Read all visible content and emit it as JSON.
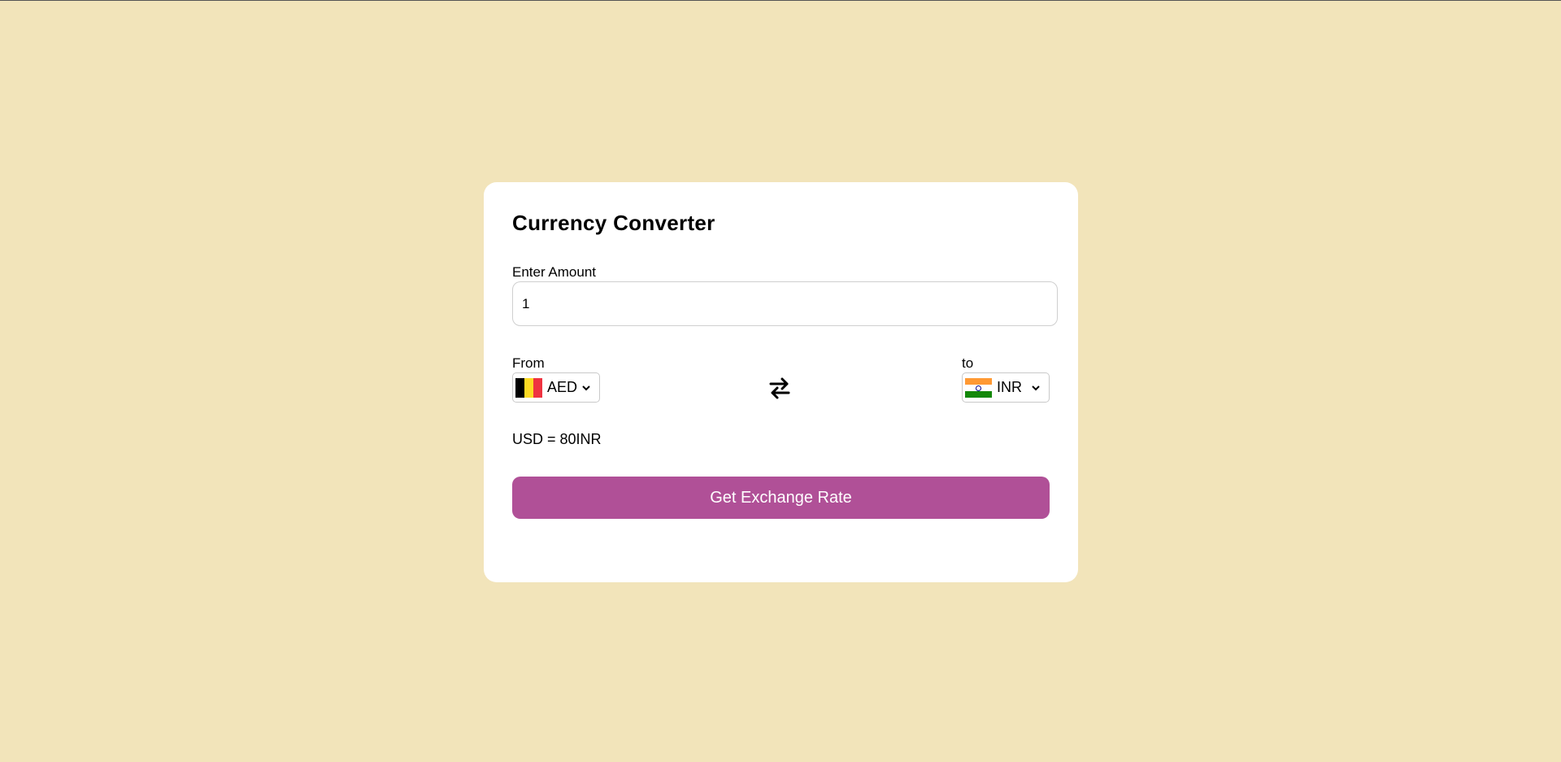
{
  "app": {
    "title": "Currency Converter"
  },
  "amount": {
    "label": "Enter Amount",
    "value": "1"
  },
  "from": {
    "label": "From",
    "currency": "AED",
    "flag": "belgium-flag-icon"
  },
  "to": {
    "label": "to",
    "currency": "INR",
    "flag": "india-flag-icon"
  },
  "swap": {
    "icon": "swap-arrows-icon"
  },
  "result": {
    "text": "USD = 80INR"
  },
  "actions": {
    "exchange_label": "Get Exchange Rate"
  },
  "colors": {
    "background": "#f2e4ba",
    "card": "#ffffff",
    "button": "#b05097",
    "button_text": "#ffffff"
  }
}
